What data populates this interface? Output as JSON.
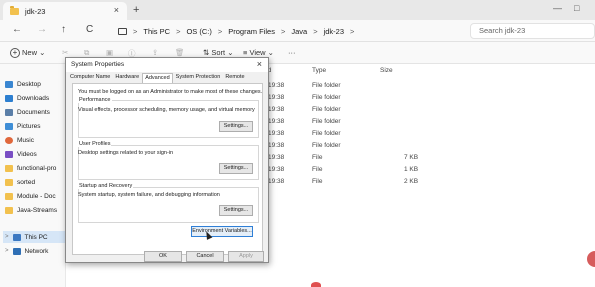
{
  "window": {
    "tab_title": "jdk-23",
    "tab_close": "×",
    "new_tab": "+",
    "minimize": "—",
    "maximize": "□"
  },
  "nav": {
    "back": "←",
    "forward": "→",
    "up": "↑",
    "refresh": "C"
  },
  "breadcrumb": {
    "separator": ">",
    "items": [
      "This PC",
      "OS (C:)",
      "Program Files",
      "Java",
      "jdk-23"
    ]
  },
  "search": {
    "placeholder": "Search jdk-23"
  },
  "commandbar": {
    "new_label": "New",
    "new_chevron": "⌄",
    "cut": "✂",
    "copy": "⧉",
    "paste": "▣",
    "rename": "Ⓘ",
    "share": "⇪",
    "delete": "🗑",
    "sort_label": "⇅ Sort ⌄",
    "view_label": "≡ View ⌄",
    "more_label": "···"
  },
  "sidebar": {
    "items": [
      {
        "label": "Desktop",
        "color": "#3a86d1"
      },
      {
        "label": "Downloads",
        "color": "#2d7fd0"
      },
      {
        "label": "Documents",
        "color": "#5b7fa8"
      },
      {
        "label": "Pictures",
        "color": "#3f8ed6"
      },
      {
        "label": "Music",
        "color": "#e0673b"
      },
      {
        "label": "Videos",
        "color": "#7a4fc4"
      },
      {
        "label": "functional-pro",
        "color": "#f2c14e"
      },
      {
        "label": "sorted",
        "color": "#f2c14e"
      },
      {
        "label": "Module - Doc",
        "color": "#f2c14e"
      },
      {
        "label": "Java-Streams",
        "color": "#f2c14e"
      },
      {
        "label": "This PC",
        "color": "#3b78c2"
      },
      {
        "label": "Network",
        "color": "#2f6fb5"
      }
    ],
    "expander": ">"
  },
  "filelist": {
    "col_modified_partial": "ed",
    "col_type": "Type",
    "col_size": "Size",
    "rows": [
      {
        "time": "19:38",
        "type": "File folder",
        "size": ""
      },
      {
        "time": "19:38",
        "type": "File folder",
        "size": ""
      },
      {
        "time": "19:38",
        "type": "File folder",
        "size": ""
      },
      {
        "time": "19:38",
        "type": "File folder",
        "size": ""
      },
      {
        "time": "19:38",
        "type": "File folder",
        "size": ""
      },
      {
        "time": "19:38",
        "type": "File folder",
        "size": ""
      },
      {
        "time": "19:38",
        "type": "File",
        "size": "7 KB"
      },
      {
        "time": "19:38",
        "type": "File",
        "size": "1 KB"
      },
      {
        "time": "19:38",
        "type": "File",
        "size": "2 KB"
      }
    ]
  },
  "dialog": {
    "title": "System Properties",
    "close": "×",
    "tabs": [
      "Computer Name",
      "Hardware",
      "Advanced",
      "System Protection",
      "Remote"
    ],
    "active_tab": "Advanced",
    "admin_note": "You must be logged on as an Administrator to make most of these changes.",
    "performance": {
      "label": "Performance",
      "desc": "Visual effects, processor scheduling, memory usage, and virtual memory",
      "button": "Settings..."
    },
    "user_profiles": {
      "label": "User Profiles",
      "desc": "Desktop settings related to your sign-in",
      "button": "Settings..."
    },
    "startup": {
      "label": "Startup and Recovery",
      "desc": "System startup, system failure, and debugging information",
      "button": "Settings..."
    },
    "env_button": "Environment Variables...",
    "ok": "OK",
    "cancel": "Cancel",
    "apply": "Apply"
  }
}
